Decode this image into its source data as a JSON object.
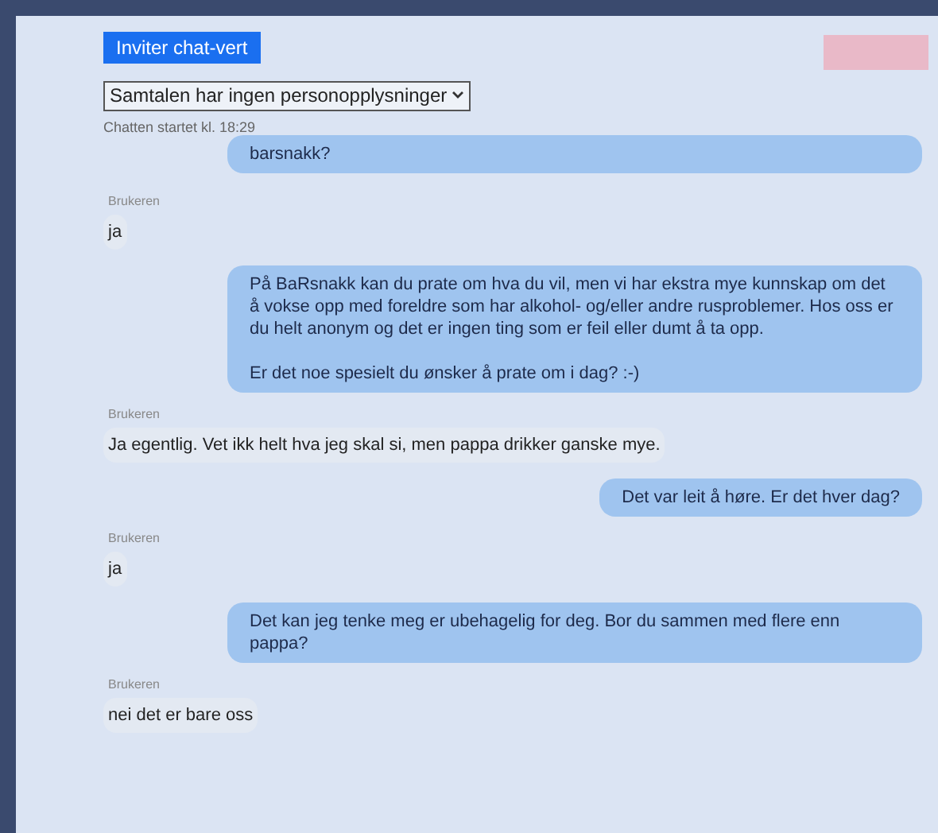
{
  "invite_button": "Inviter chat-vert",
  "privacy_select": {
    "value": "Samtalen har ingen personopplysninger"
  },
  "chat_started": "Chatten startet kl. 18:29",
  "messages": [
    {
      "kind": "host",
      "text": "barsnakk?"
    },
    {
      "kind": "user",
      "sender": "Brukeren",
      "text": "ja"
    },
    {
      "kind": "host",
      "text": "På BaRsnakk kan du prate om hva du vil, men vi har ekstra mye kunnskap om det å vokse opp med foreldre som har alkohol- og/eller andre rusproblemer. Hos oss er du helt anonym og det er ingen ting som er feil eller dumt å ta opp.\n\nEr det noe spesielt du ønsker å prate om i dag? :-)"
    },
    {
      "kind": "user",
      "sender": "Brukeren",
      "text": "Ja egentlig. Vet ikk helt hva jeg skal si, men pappa drikker ganske mye."
    },
    {
      "kind": "host",
      "text": "Det var leit å høre. Er det hver dag?"
    },
    {
      "kind": "user",
      "sender": "Brukeren",
      "text": "ja"
    },
    {
      "kind": "host",
      "text": "Det kan jeg tenke meg er ubehagelig for deg. Bor du sammen med flere enn pappa?"
    },
    {
      "kind": "user",
      "sender": "Brukeren",
      "text": "nei det er bare oss"
    }
  ]
}
